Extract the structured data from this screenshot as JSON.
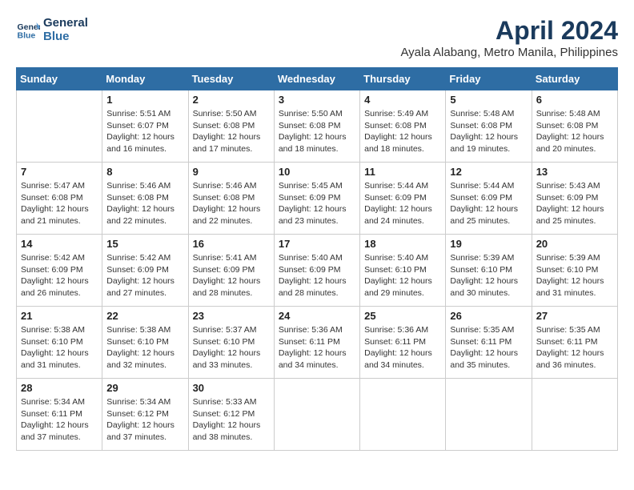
{
  "logo": {
    "line1": "General",
    "line2": "Blue"
  },
  "title": "April 2024",
  "subtitle": "Ayala Alabang, Metro Manila, Philippines",
  "weekdays": [
    "Sunday",
    "Monday",
    "Tuesday",
    "Wednesday",
    "Thursday",
    "Friday",
    "Saturday"
  ],
  "weeks": [
    [
      {
        "day": "",
        "info": ""
      },
      {
        "day": "1",
        "info": "Sunrise: 5:51 AM\nSunset: 6:07 PM\nDaylight: 12 hours\nand 16 minutes."
      },
      {
        "day": "2",
        "info": "Sunrise: 5:50 AM\nSunset: 6:08 PM\nDaylight: 12 hours\nand 17 minutes."
      },
      {
        "day": "3",
        "info": "Sunrise: 5:50 AM\nSunset: 6:08 PM\nDaylight: 12 hours\nand 18 minutes."
      },
      {
        "day": "4",
        "info": "Sunrise: 5:49 AM\nSunset: 6:08 PM\nDaylight: 12 hours\nand 18 minutes."
      },
      {
        "day": "5",
        "info": "Sunrise: 5:48 AM\nSunset: 6:08 PM\nDaylight: 12 hours\nand 19 minutes."
      },
      {
        "day": "6",
        "info": "Sunrise: 5:48 AM\nSunset: 6:08 PM\nDaylight: 12 hours\nand 20 minutes."
      }
    ],
    [
      {
        "day": "7",
        "info": "Sunrise: 5:47 AM\nSunset: 6:08 PM\nDaylight: 12 hours\nand 21 minutes."
      },
      {
        "day": "8",
        "info": "Sunrise: 5:46 AM\nSunset: 6:08 PM\nDaylight: 12 hours\nand 22 minutes."
      },
      {
        "day": "9",
        "info": "Sunrise: 5:46 AM\nSunset: 6:08 PM\nDaylight: 12 hours\nand 22 minutes."
      },
      {
        "day": "10",
        "info": "Sunrise: 5:45 AM\nSunset: 6:09 PM\nDaylight: 12 hours\nand 23 minutes."
      },
      {
        "day": "11",
        "info": "Sunrise: 5:44 AM\nSunset: 6:09 PM\nDaylight: 12 hours\nand 24 minutes."
      },
      {
        "day": "12",
        "info": "Sunrise: 5:44 AM\nSunset: 6:09 PM\nDaylight: 12 hours\nand 25 minutes."
      },
      {
        "day": "13",
        "info": "Sunrise: 5:43 AM\nSunset: 6:09 PM\nDaylight: 12 hours\nand 25 minutes."
      }
    ],
    [
      {
        "day": "14",
        "info": "Sunrise: 5:42 AM\nSunset: 6:09 PM\nDaylight: 12 hours\nand 26 minutes."
      },
      {
        "day": "15",
        "info": "Sunrise: 5:42 AM\nSunset: 6:09 PM\nDaylight: 12 hours\nand 27 minutes."
      },
      {
        "day": "16",
        "info": "Sunrise: 5:41 AM\nSunset: 6:09 PM\nDaylight: 12 hours\nand 28 minutes."
      },
      {
        "day": "17",
        "info": "Sunrise: 5:40 AM\nSunset: 6:09 PM\nDaylight: 12 hours\nand 28 minutes."
      },
      {
        "day": "18",
        "info": "Sunrise: 5:40 AM\nSunset: 6:10 PM\nDaylight: 12 hours\nand 29 minutes."
      },
      {
        "day": "19",
        "info": "Sunrise: 5:39 AM\nSunset: 6:10 PM\nDaylight: 12 hours\nand 30 minutes."
      },
      {
        "day": "20",
        "info": "Sunrise: 5:39 AM\nSunset: 6:10 PM\nDaylight: 12 hours\nand 31 minutes."
      }
    ],
    [
      {
        "day": "21",
        "info": "Sunrise: 5:38 AM\nSunset: 6:10 PM\nDaylight: 12 hours\nand 31 minutes."
      },
      {
        "day": "22",
        "info": "Sunrise: 5:38 AM\nSunset: 6:10 PM\nDaylight: 12 hours\nand 32 minutes."
      },
      {
        "day": "23",
        "info": "Sunrise: 5:37 AM\nSunset: 6:10 PM\nDaylight: 12 hours\nand 33 minutes."
      },
      {
        "day": "24",
        "info": "Sunrise: 5:36 AM\nSunset: 6:11 PM\nDaylight: 12 hours\nand 34 minutes."
      },
      {
        "day": "25",
        "info": "Sunrise: 5:36 AM\nSunset: 6:11 PM\nDaylight: 12 hours\nand 34 minutes."
      },
      {
        "day": "26",
        "info": "Sunrise: 5:35 AM\nSunset: 6:11 PM\nDaylight: 12 hours\nand 35 minutes."
      },
      {
        "day": "27",
        "info": "Sunrise: 5:35 AM\nSunset: 6:11 PM\nDaylight: 12 hours\nand 36 minutes."
      }
    ],
    [
      {
        "day": "28",
        "info": "Sunrise: 5:34 AM\nSunset: 6:11 PM\nDaylight: 12 hours\nand 37 minutes."
      },
      {
        "day": "29",
        "info": "Sunrise: 5:34 AM\nSunset: 6:12 PM\nDaylight: 12 hours\nand 37 minutes."
      },
      {
        "day": "30",
        "info": "Sunrise: 5:33 AM\nSunset: 6:12 PM\nDaylight: 12 hours\nand 38 minutes."
      },
      {
        "day": "",
        "info": ""
      },
      {
        "day": "",
        "info": ""
      },
      {
        "day": "",
        "info": ""
      },
      {
        "day": "",
        "info": ""
      }
    ]
  ]
}
